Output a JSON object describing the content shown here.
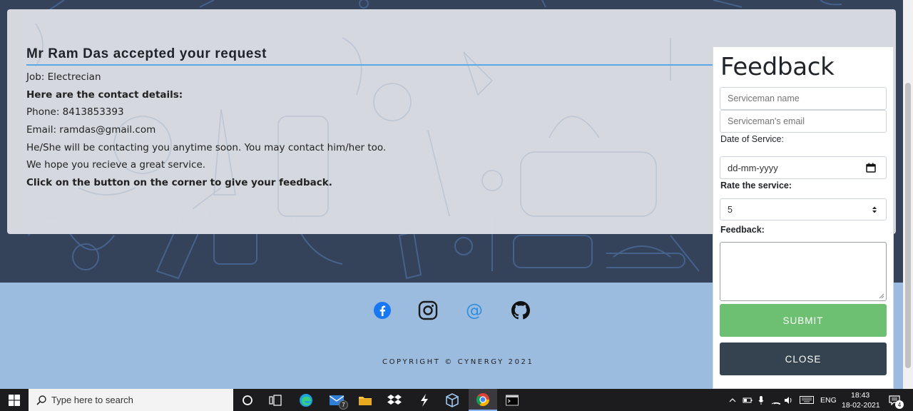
{
  "notice": {
    "title": "Mr Ram Das accepted your request",
    "lines": [
      {
        "text": "Job: Electrecian",
        "bold": false
      },
      {
        "text": "Here are the contact details:",
        "bold": true
      },
      {
        "text": "Phone: 8413853393",
        "bold": false
      },
      {
        "text": "Email: ramdas@gmail.com",
        "bold": false
      },
      {
        "text": "He/She will be contacting you anytime soon. You may contact him/her too.",
        "bold": false
      },
      {
        "text": "We hope you recieve a great service.",
        "bold": false
      },
      {
        "text": "Click on the button on the corner to give your feedback.",
        "bold": true
      }
    ]
  },
  "feedback": {
    "title": "Feedback",
    "name_placeholder": "Serviceman name",
    "email_placeholder": "Serviceman's email",
    "date_label": "Date of Service:",
    "date_placeholder": "dd-mm-yyyy",
    "rate_label": "Rate the service:",
    "rate_value": "5",
    "feedback_label": "Feedback:",
    "submit_label": "SUBMIT",
    "close_label": "CLOSE",
    "colors": {
      "submit": "#6dbf71",
      "close": "#34434f"
    }
  },
  "footer": {
    "social": [
      {
        "icon": "facebook-icon"
      },
      {
        "icon": "instagram-icon"
      },
      {
        "icon": "email-at-icon"
      },
      {
        "icon": "github-icon"
      }
    ],
    "copyright": "COPYRIGHT © CYNERGY 2021"
  },
  "taskbar": {
    "search_placeholder": "Type here to search",
    "mail_badge": "7",
    "language": "ENG",
    "time": "18:43",
    "date": "18-02-2021",
    "notification_count": "4"
  }
}
